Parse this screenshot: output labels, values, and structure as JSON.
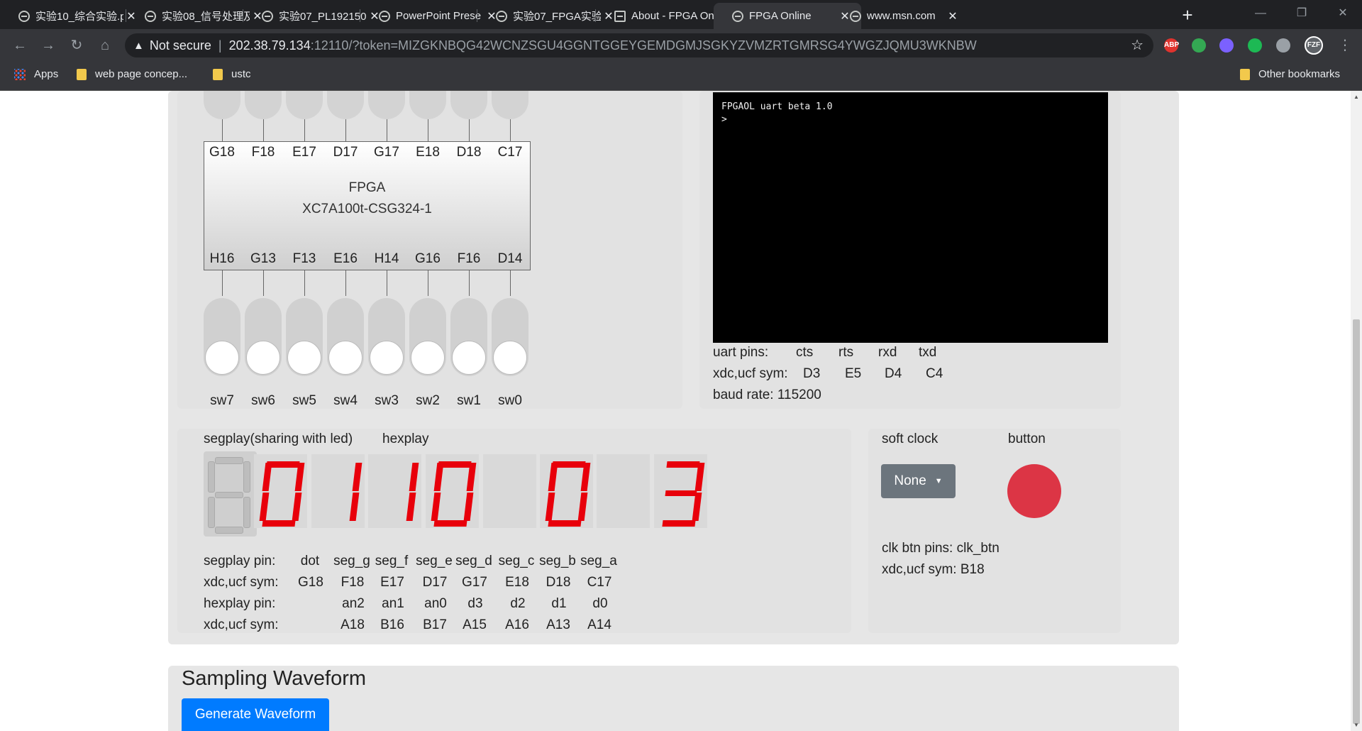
{
  "browser": {
    "tabs": [
      {
        "title": "实验10_综合实验.p",
        "active": false
      },
      {
        "title": "实验08_信号处理及",
        "active": false
      },
      {
        "title": "实验07_PL192150",
        "active": false
      },
      {
        "title": "PowerPoint Prese",
        "active": false
      },
      {
        "title": "实验07_FPGA实验",
        "active": false
      },
      {
        "title": "About - FPGA On",
        "active": false
      },
      {
        "title": "FPGA Online",
        "active": true
      },
      {
        "title": "www.msn.com",
        "active": false
      }
    ],
    "new_tab_icon": "plus-icon",
    "address": {
      "security": "Not secure",
      "separator": "|",
      "host": "202.38.79.134",
      "rest": ":12110/?token=MIZGKNBQG42WCNZSGU4GGNTGGEYGEMDGMJSGKYZVMZRTGMRSG4YWGZJQMU3WKNBW"
    },
    "extensions": [
      {
        "label": "ABP",
        "color": "#e0332e"
      },
      {
        "label": "",
        "color": "#34a853"
      },
      {
        "label": "",
        "color": "#7b61ff"
      },
      {
        "label": "",
        "color": "#1db954"
      },
      {
        "label": "",
        "color": "#9aa0a6"
      },
      {
        "label": "FZF",
        "color": "#5f6368"
      }
    ],
    "bookmarks": [
      {
        "label": "Apps",
        "icon": "apps-grid-icon"
      },
      {
        "label": "web page concep...",
        "icon": "folder-icon"
      },
      {
        "label": "ustc",
        "icon": "folder-icon"
      }
    ],
    "other_bookmarks": "Other bookmarks"
  },
  "fpga": {
    "top_pins": [
      "G18",
      "F18",
      "E17",
      "D17",
      "G17",
      "E18",
      "D18",
      "C17"
    ],
    "chip_name": "FPGA",
    "chip_part": "XC7A100t-CSG324-1",
    "bottom_pins": [
      "H16",
      "G13",
      "F13",
      "E16",
      "H14",
      "G16",
      "F16",
      "D14"
    ],
    "switches": [
      "sw7",
      "sw6",
      "sw5",
      "sw4",
      "sw3",
      "sw2",
      "sw1",
      "sw0"
    ]
  },
  "uart": {
    "terminal_lines": [
      "FPGAOL uart beta 1.0",
      ">"
    ],
    "pins_label": "uart pins:",
    "pins": [
      "cts",
      "rts",
      "rxd",
      "txd"
    ],
    "sym_label": "xdc,ucf sym:",
    "syms": [
      "D3",
      "E5",
      "D4",
      "C4"
    ],
    "baud": "baud rate: 115200"
  },
  "display": {
    "segplay_title": "segplay(sharing with led)",
    "hexplay_title": "hexplay",
    "digits": [
      "0",
      "1",
      "1",
      "0",
      "",
      "0",
      "",
      "3"
    ],
    "rows": [
      {
        "label": "segplay pin:",
        "cells": [
          "dot",
          "seg_g",
          "seg_f",
          "seg_e",
          "seg_d",
          "seg_c",
          "seg_b",
          "seg_a"
        ]
      },
      {
        "label": "xdc,ucf sym:",
        "cells": [
          "G18",
          "F18",
          "E17",
          "D17",
          "G17",
          "E18",
          "D18",
          "C17"
        ]
      },
      {
        "label": "hexplay pin:",
        "cells": [
          "",
          "an2",
          "an1",
          "an0",
          "d3",
          "d2",
          "d1",
          "d0"
        ]
      },
      {
        "label": "xdc,ucf sym:",
        "cells": [
          "",
          "A18",
          "B16",
          "B17",
          "A15",
          "A16",
          "A13",
          "A14"
        ]
      }
    ]
  },
  "clock": {
    "soft_clock_label": "soft clock",
    "button_label": "button",
    "dropdown_value": "None",
    "btn_pins": "clk btn pins: clk_btn",
    "btn_sym": "xdc,ucf sym:   B18",
    "button_color": "#dc3545"
  },
  "waveform": {
    "title": "Sampling Waveform",
    "button": "Generate Waveform"
  }
}
